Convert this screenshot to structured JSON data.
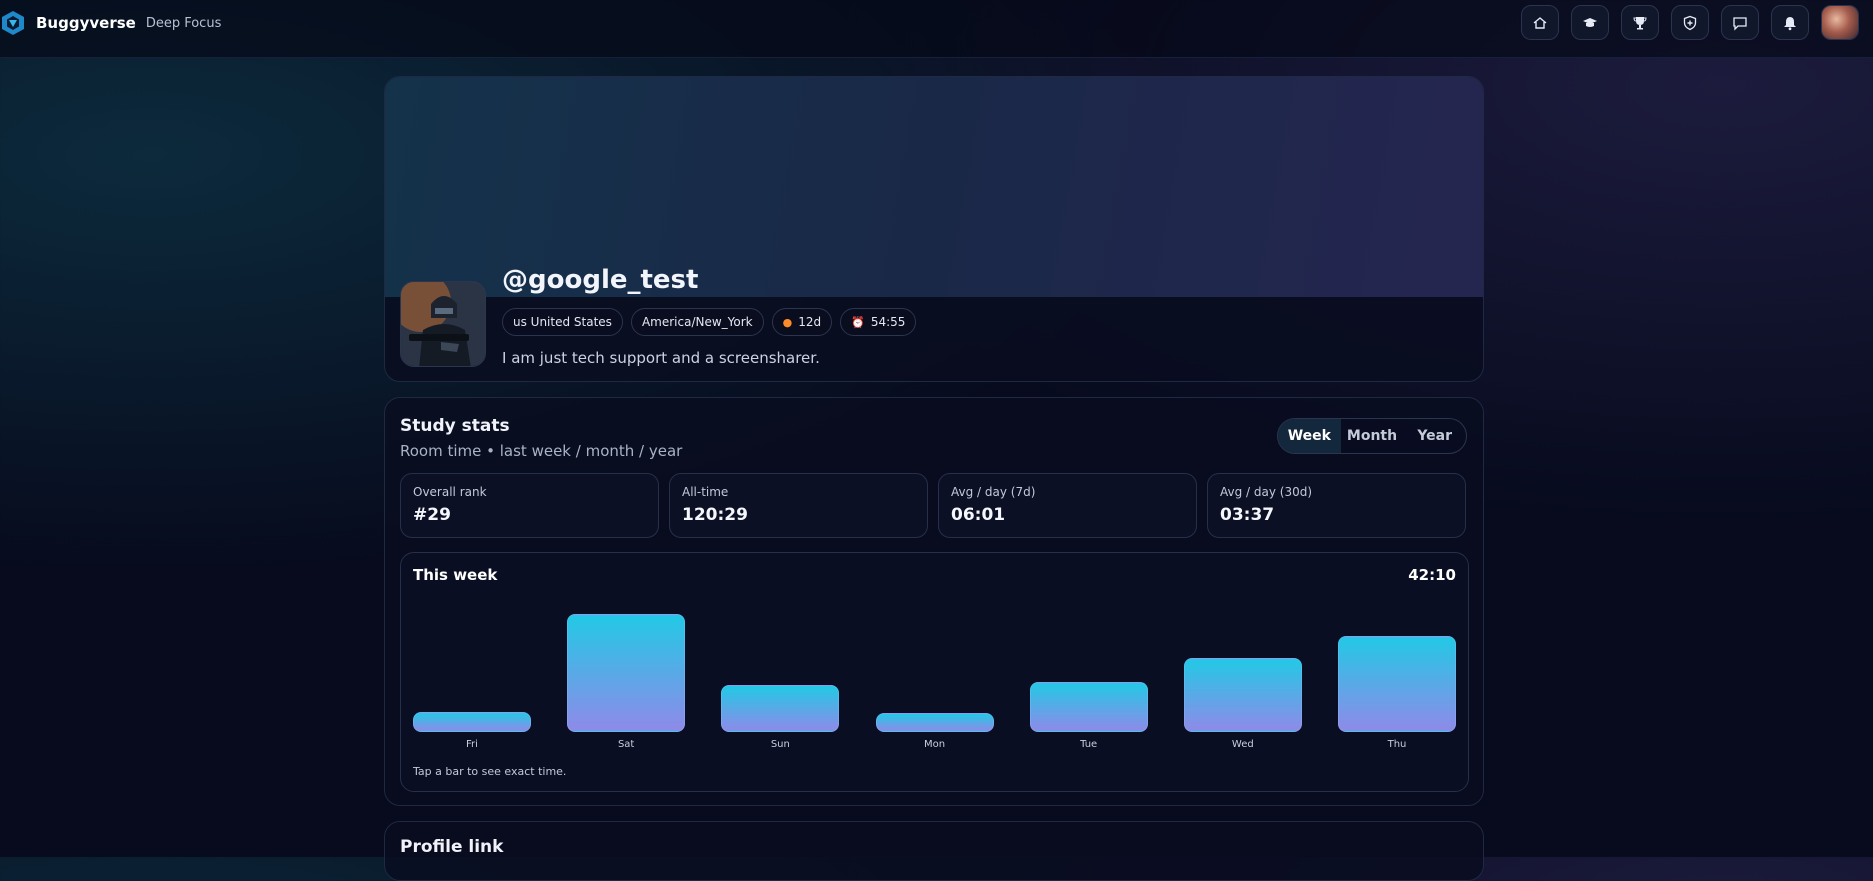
{
  "app": {
    "name": "Buggyverse",
    "subtitle": "Deep Focus"
  },
  "nav": {
    "buttons": [
      {
        "icon": "home-icon"
      },
      {
        "icon": "graduation-cap-icon"
      },
      {
        "icon": "trophy-icon"
      },
      {
        "icon": "shield-plus-icon"
      },
      {
        "icon": "chat-icon"
      },
      {
        "icon": "bell-icon"
      }
    ]
  },
  "profile": {
    "handle": "@google_test",
    "chips": {
      "country": "us United States",
      "timezone": "America/New_York",
      "streak": "12d",
      "timer": "54:55"
    },
    "bio": "I am just tech support and a screensharer."
  },
  "stats": {
    "title": "Study stats",
    "subtitle": "Room time • last week / month / year",
    "periods": [
      "Week",
      "Month",
      "Year"
    ],
    "active_period": "Week",
    "metrics": [
      {
        "label": "Overall rank",
        "value": "#29"
      },
      {
        "label": "All-time",
        "value": "120:29"
      },
      {
        "label": "Avg / day (7d)",
        "value": "06:01"
      },
      {
        "label": "Avg / day (30d)",
        "value": "03:37"
      }
    ],
    "week": {
      "title": "This week",
      "total": "42:10",
      "hint": "Tap a bar to see exact time."
    }
  },
  "chart_data": {
    "type": "bar",
    "categories": [
      "Fri",
      "Sat",
      "Sun",
      "Mon",
      "Tue",
      "Wed",
      "Thu"
    ],
    "values": [
      2.1,
      12.5,
      5.0,
      2.0,
      5.3,
      7.8,
      10.2
    ],
    "ylim": [
      0,
      12.5
    ],
    "colors": {
      "top": "#22c9e6",
      "bottom": "#8f8ae8"
    }
  },
  "profile_link": {
    "title": "Profile link"
  }
}
